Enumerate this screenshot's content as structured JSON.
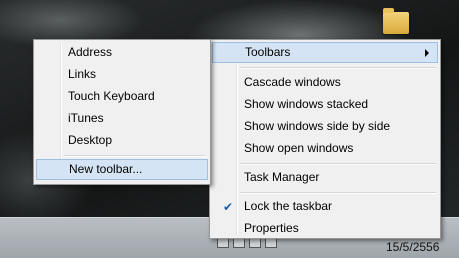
{
  "context_menu": {
    "items": [
      {
        "label": "Toolbars"
      },
      {
        "label": "Cascade windows"
      },
      {
        "label": "Show windows stacked"
      },
      {
        "label": "Show windows side by side"
      },
      {
        "label": "Show open windows"
      },
      {
        "label": "Task Manager"
      },
      {
        "label": "Lock the taskbar",
        "checked": true
      },
      {
        "label": "Properties"
      }
    ]
  },
  "toolbars_submenu": {
    "items": [
      {
        "label": "Address"
      },
      {
        "label": "Links"
      },
      {
        "label": "Touch Keyboard"
      },
      {
        "label": "iTunes"
      },
      {
        "label": "Desktop"
      },
      {
        "label": "New toolbar..."
      }
    ]
  },
  "taskbar": {
    "clock_date": "15/5/2556"
  },
  "colors": {
    "highlight": "#d5e4f4",
    "highlight_border": "#9ebfe3",
    "menu_background": "#f0f0f0"
  }
}
